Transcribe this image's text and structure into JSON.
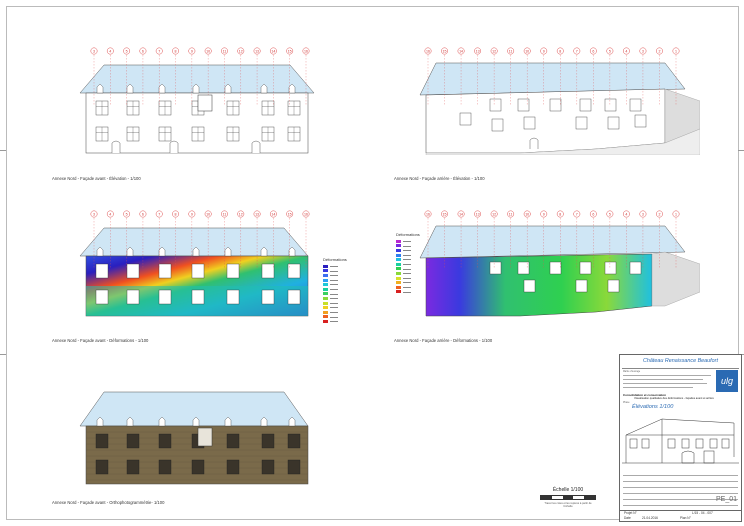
{
  "sheet": {
    "captions": {
      "front_elevation": "Annexe Nord - Façade avant - Élévation - 1/100",
      "rear_elevation": "Annexe Nord - Façade arrière - Élévation - 1/100",
      "front_deformations": "Annexe Nord - Façade avant - Déformations - 1/100",
      "rear_deformations": "Annexe Nord - Façade arrière - Déformations - 1/100",
      "front_ortho": "Annexe Nord - Façade avant - Orthophotogrammétrie- 1/100"
    },
    "axis_labels_front": [
      "3",
      "4",
      "5",
      "6",
      "7",
      "8",
      "9",
      "10",
      "11",
      "12",
      "13",
      "14",
      "15",
      "16"
    ],
    "axis_labels_rear": [
      "16",
      "15",
      "14",
      "13",
      "12",
      "11",
      "10",
      "9",
      "8",
      "7",
      "6",
      "5",
      "4",
      "3",
      "2",
      "1"
    ]
  },
  "legend_front": {
    "title": "Déformations",
    "colors": [
      "#2b1fbf",
      "#3a3adf",
      "#3f6ff0",
      "#2fa0f5",
      "#1fc8d8",
      "#1ad0a0",
      "#3ad060",
      "#8ad93a",
      "#c8e02a",
      "#f0d020",
      "#f0a020",
      "#ee6020",
      "#d82020"
    ]
  },
  "legend_rear": {
    "title": "Déformations",
    "colors": [
      "#b82ad0",
      "#7a2ae0",
      "#3a3adf",
      "#2f7ff0",
      "#1fc0e0",
      "#1ad0a0",
      "#2fd050",
      "#8ad93a",
      "#d8e02a",
      "#f0b020",
      "#ee6020",
      "#d82020"
    ]
  },
  "scale": {
    "label": "Échelle 1/100",
    "note": "Tracer les cotes et les repères à partir de l'échelle"
  },
  "cartouche": {
    "title": "Château Renaissance Beaufort",
    "logo": "ulg",
    "subject": "Consolidation et conservation",
    "subject_detail": "Visualisation qualitative des déformations - façades avant et arrière",
    "drawing_title": "Élévations 1/100",
    "sheet_code": "PE_01",
    "project_label": "Projet N°",
    "project_code": "L/15 - 04 - 007",
    "date_label": "Date",
    "date_value": "21.04.2016",
    "sheet_label": "Plan N°"
  },
  "colors": {
    "roof": "#cfe6f5",
    "axis_marker": "#e05050",
    "accent": "#2a6ab3"
  }
}
